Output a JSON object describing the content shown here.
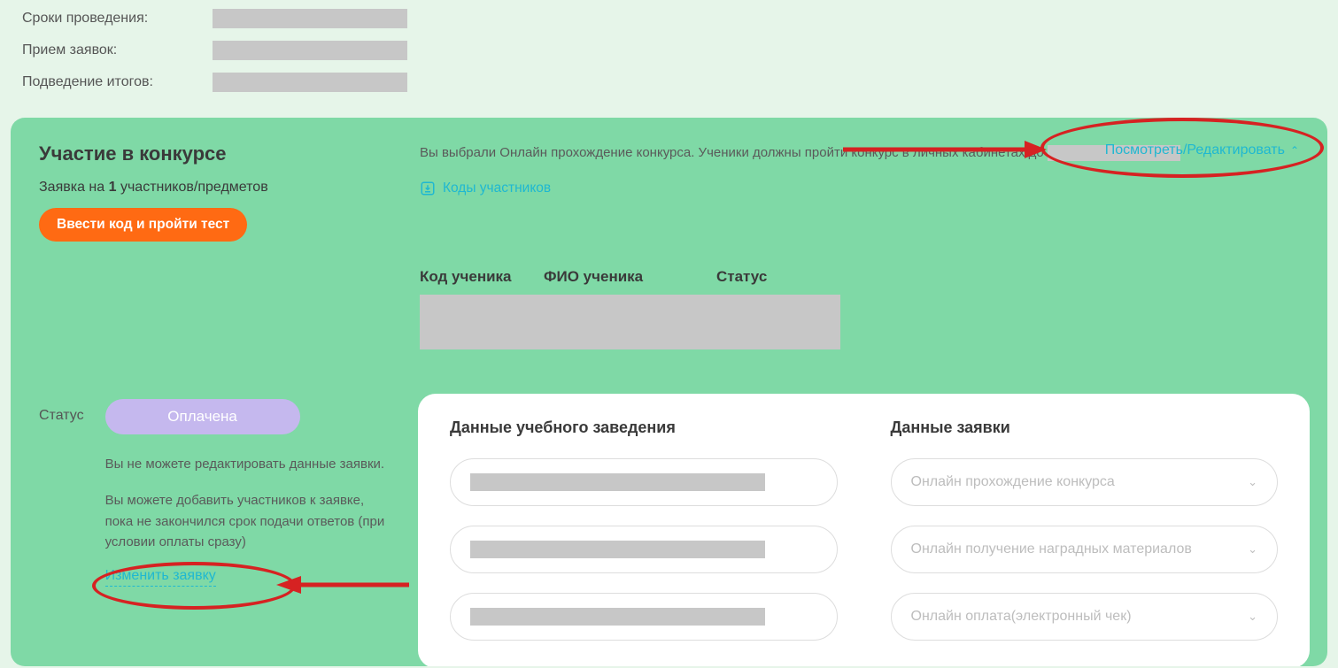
{
  "meta": {
    "dates_label": "Сроки проведения:",
    "apps_label": "Прием заявок:",
    "results_label": "Подведение итогов:"
  },
  "panel": {
    "title": "Участие в конкурсе",
    "app_prefix": "Заявка на",
    "app_count": "1",
    "app_suffix": "участников/предметов",
    "enter_code_btn": "Ввести код и пройти тест",
    "desc_line": "Вы выбрали Онлайн прохождение конкурса. Ученики должны пройти конкурс в личных кабинетах до",
    "codes_link": "Коды участников",
    "view_edit": "Посмотреть/Редактировать",
    "table": {
      "col_code": "Код ученика",
      "col_name": "ФИО ученика",
      "col_status": "Статус"
    }
  },
  "status": {
    "label": "Статус",
    "pill": "Оплачена",
    "note1": "Вы не можете редактировать данные заявки.",
    "note2": "Вы можете добавить участников к заявке, пока не закончился срок подачи ответов (при условии оплаты сразу)",
    "edit_link": "Изменить заявку"
  },
  "card": {
    "left_title": "Данные учебного заведения",
    "right_title": "Данные заявки",
    "sel1": "Онлайн прохождение конкурса",
    "sel2": "Онлайн получение наградных материалов",
    "sel3": "Онлайн оплата(электронный чек)"
  }
}
